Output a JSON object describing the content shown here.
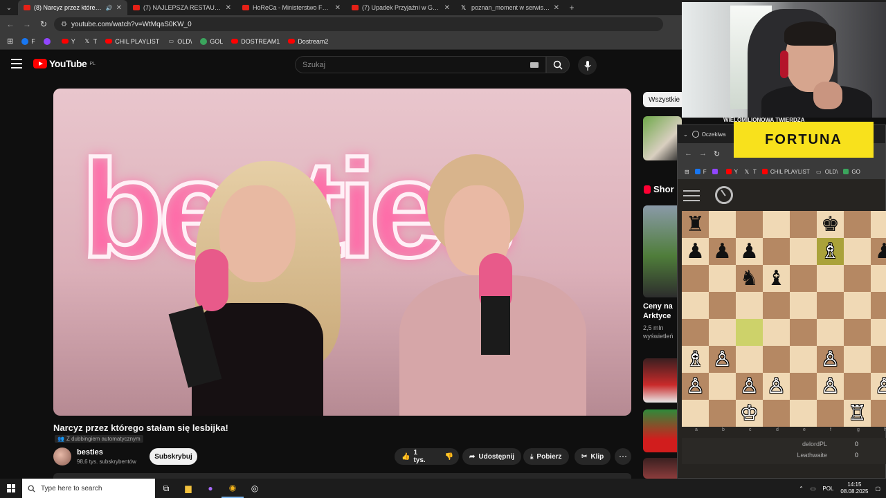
{
  "browser": {
    "tabs": [
      {
        "title": "(8) Narcyz przez którego st",
        "active": true,
        "audio": true
      },
      {
        "title": "(7) NAJLEPSZA RESTAURACJA w",
        "active": false
      },
      {
        "title": "HoReCa - Ministerstwo Fundusz",
        "active": false
      },
      {
        "title": "(7) Upadek Przyjaźni w Gen-Z",
        "active": false
      },
      {
        "title": "poznan_moment w serwisie X:",
        "active": false
      }
    ],
    "url": "youtube.com/watch?v=WtMqaS0KW_0",
    "bookmarks": [
      {
        "label": "F",
        "icon": "facebook-icon",
        "color": "#1877f2"
      },
      {
        "label": "",
        "icon": "twitch-icon",
        "color": "#9146ff"
      },
      {
        "label": "Y",
        "icon": "youtube-icon",
        "color": "#ff0000"
      },
      {
        "label": "T",
        "icon": "x-icon",
        "color": "#ffffff"
      },
      {
        "label": "CHIL PLAYLIST",
        "icon": "youtube-icon",
        "color": "#ff0000"
      },
      {
        "label": "OLD\\",
        "icon": "folder-icon",
        "color": "#cccccc"
      },
      {
        "label": "GOL",
        "icon": "g-icon",
        "color": "#3ba55d"
      },
      {
        "label": "DOSTREAM1",
        "icon": "youtube-icon",
        "color": "#ff0000"
      },
      {
        "label": "Dostream2",
        "icon": "youtube-icon",
        "color": "#ff0000"
      }
    ]
  },
  "youtube": {
    "logo": "YouTube",
    "region": "PL",
    "search_placeholder": "Szukaj",
    "video": {
      "title": "Narcyz przez którego stałam się lesbijka!",
      "dubbing": "Z dubbingiem automatycznym",
      "neon_text": "besties"
    },
    "channel": {
      "name": "besties",
      "subscribers": "98,6 tys. subskrybentów"
    },
    "subscribe_label": "Subskrybuj",
    "actions": {
      "likes": "1 tys.",
      "share": "Udostępnij",
      "download": "Pobierz",
      "clip": "Klip",
      "more": "⋯"
    },
    "sidebar": {
      "chip": "Wszystkie",
      "shorts_label": "Shor",
      "short_title": "Ceny na Arktyce",
      "short_views": "2,5 mln wyświetleń"
    }
  },
  "overlay": {
    "banner_text": "WIELOMILIONOWA TWIERDZA",
    "sponsor": "FORTUNA"
  },
  "chess_window": {
    "tab_title": "Oczekiwa",
    "bookmarks": [
      "F",
      "",
      "Y",
      "T",
      "CHIL PLAYLIST",
      "OLD\\",
      "GO"
    ],
    "files": [
      "a",
      "b",
      "c",
      "d",
      "e",
      "f",
      "g",
      "h"
    ],
    "pieces": [
      {
        "sq": "a8",
        "glyph": "♜",
        "color": "b"
      },
      {
        "sq": "f8",
        "glyph": "♚",
        "color": "b"
      },
      {
        "sq": "a7",
        "glyph": "♟",
        "color": "b"
      },
      {
        "sq": "b7",
        "glyph": "♟",
        "color": "b"
      },
      {
        "sq": "c7",
        "glyph": "♟",
        "color": "b"
      },
      {
        "sq": "f7",
        "glyph": "♗",
        "color": "w"
      },
      {
        "sq": "h7",
        "glyph": "♟",
        "color": "b"
      },
      {
        "sq": "c6",
        "glyph": "♞",
        "color": "b"
      },
      {
        "sq": "d6",
        "glyph": "♝",
        "color": "b"
      },
      {
        "sq": "a3",
        "glyph": "♗",
        "color": "w"
      },
      {
        "sq": "b3",
        "glyph": "♙",
        "color": "w"
      },
      {
        "sq": "f3",
        "glyph": "♙",
        "color": "w"
      },
      {
        "sq": "a2",
        "glyph": "♙",
        "color": "w"
      },
      {
        "sq": "c2",
        "glyph": "♙",
        "color": "w"
      },
      {
        "sq": "d2",
        "glyph": "♙",
        "color": "w"
      },
      {
        "sq": "f2",
        "glyph": "♙",
        "color": "w"
      },
      {
        "sq": "h2",
        "glyph": "♙",
        "color": "w"
      },
      {
        "sq": "c1",
        "glyph": "♔",
        "color": "w"
      },
      {
        "sq": "g1",
        "glyph": "♖",
        "color": "w"
      }
    ],
    "highlights": [
      {
        "sq": "f7",
        "style": "hl2"
      },
      {
        "sq": "c4",
        "style": "hl"
      }
    ],
    "players": [
      {
        "name": "delordPL",
        "score": "0"
      },
      {
        "name": "Leathwaite",
        "score": "0"
      }
    ]
  },
  "taskbar": {
    "search_placeholder": "Type here to search",
    "language": "POL",
    "time": "14:15",
    "date": "08.08.2025"
  }
}
